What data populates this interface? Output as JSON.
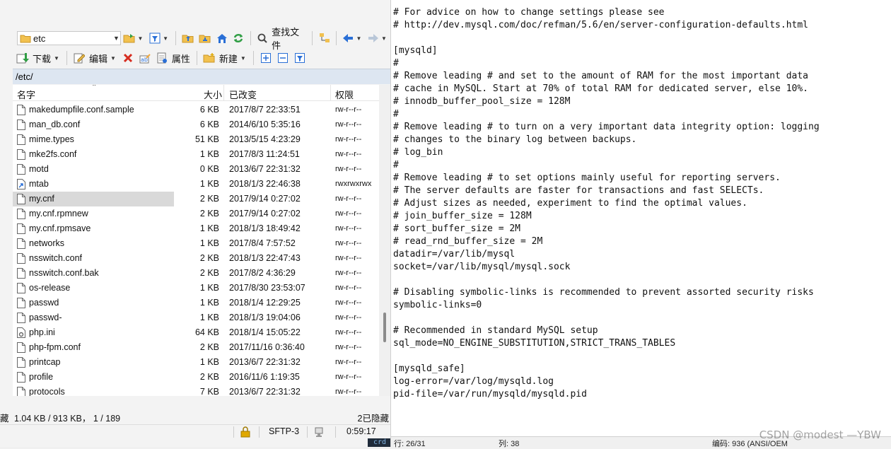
{
  "colors": {
    "accent": "#2a6fd6",
    "folder": "#f2c14e",
    "delete": "#d62d20",
    "refresh": "#2f9e44",
    "selected_row": "#d9d9d9",
    "path_bar": "#dde6f1"
  },
  "toolbar1": {
    "path_combo_value": "etc",
    "find_files_label": "查找文件"
  },
  "toolbar2": {
    "download_label": "下载",
    "edit_label": "编辑",
    "properties_label": "属性",
    "new_label": "新建"
  },
  "path_bar": {
    "value": "/etc/"
  },
  "columns": {
    "name": "名字",
    "size": "大小",
    "modified": "已改变",
    "perms": "权限"
  },
  "files": [
    {
      "name": "makedumpfile.conf.sample",
      "size": "6 KB",
      "date": "2017/8/7 22:33:51",
      "perm": "rw-r--r--",
      "icon": "file-icon"
    },
    {
      "name": "man_db.conf",
      "size": "6 KB",
      "date": "2014/6/10 5:35:16",
      "perm": "rw-r--r--",
      "icon": "file-icon"
    },
    {
      "name": "mime.types",
      "size": "51 KB",
      "date": "2013/5/15 4:23:29",
      "perm": "rw-r--r--",
      "icon": "file-icon"
    },
    {
      "name": "mke2fs.conf",
      "size": "1 KB",
      "date": "2017/8/3 11:24:51",
      "perm": "rw-r--r--",
      "icon": "file-icon"
    },
    {
      "name": "motd",
      "size": "0 KB",
      "date": "2013/6/7 22:31:32",
      "perm": "rw-r--r--",
      "icon": "file-icon"
    },
    {
      "name": "mtab",
      "size": "1 KB",
      "date": "2018/1/3 22:46:38",
      "perm": "rwxrwxrwx",
      "icon": "link-icon"
    },
    {
      "name": "my.cnf",
      "size": "2 KB",
      "date": "2017/9/14 0:27:02",
      "perm": "rw-r--r--",
      "icon": "file-icon"
    },
    {
      "name": "my.cnf.rpmnew",
      "size": "2 KB",
      "date": "2017/9/14 0:27:02",
      "perm": "rw-r--r--",
      "icon": "file-icon"
    },
    {
      "name": "my.cnf.rpmsave",
      "size": "1 KB",
      "date": "2018/1/3 18:49:42",
      "perm": "rw-r--r--",
      "icon": "file-icon"
    },
    {
      "name": "networks",
      "size": "1 KB",
      "date": "2017/8/4 7:57:52",
      "perm": "rw-r--r--",
      "icon": "file-icon"
    },
    {
      "name": "nsswitch.conf",
      "size": "2 KB",
      "date": "2018/1/3 22:47:43",
      "perm": "rw-r--r--",
      "icon": "file-icon"
    },
    {
      "name": "nsswitch.conf.bak",
      "size": "2 KB",
      "date": "2017/8/2 4:36:29",
      "perm": "rw-r--r--",
      "icon": "file-icon"
    },
    {
      "name": "os-release",
      "size": "1 KB",
      "date": "2017/8/30 23:53:07",
      "perm": "rw-r--r--",
      "icon": "file-icon"
    },
    {
      "name": "passwd",
      "size": "1 KB",
      "date": "2018/1/4 12:29:25",
      "perm": "rw-r--r--",
      "icon": "file-icon"
    },
    {
      "name": "passwd-",
      "size": "1 KB",
      "date": "2018/1/3 19:04:06",
      "perm": "rw-r--r--",
      "icon": "file-icon"
    },
    {
      "name": "php.ini",
      "size": "64 KB",
      "date": "2018/1/4 15:05:22",
      "perm": "rw-r--r--",
      "icon": "settings-file-icon"
    },
    {
      "name": "php-fpm.conf",
      "size": "2 KB",
      "date": "2017/11/16 0:36:40",
      "perm": "rw-r--r--",
      "icon": "file-icon"
    },
    {
      "name": "printcap",
      "size": "1 KB",
      "date": "2013/6/7 22:31:32",
      "perm": "rw-r--r--",
      "icon": "file-icon"
    },
    {
      "name": "profile",
      "size": "2 KB",
      "date": "2016/11/6 1:19:35",
      "perm": "rw-r--r--",
      "icon": "file-icon"
    },
    {
      "name": "protocols",
      "size": "7 KB",
      "date": "2013/6/7 22:31:32",
      "perm": "rw-r--r--",
      "icon": "file-icon"
    }
  ],
  "selected_file": "my.cnf",
  "status": {
    "left_cut": "藏",
    "summary": "1.04 KB / 913 KB， 1 / 189",
    "hidden": "2已隐藏",
    "protocol": "SFTP-3",
    "elapsed": "0:59:17",
    "dark_strip": "crd"
  },
  "editor": {
    "lines": [
      "# For advice on how to change settings please see",
      "# http://dev.mysql.com/doc/refman/5.6/en/server-configuration-defaults.html",
      "",
      "[mysqld]",
      "#",
      "# Remove leading # and set to the amount of RAM for the most important data",
      "# cache in MySQL. Start at 70% of total RAM for dedicated server, else 10%.",
      "# innodb_buffer_pool_size = 128M",
      "#",
      "# Remove leading # to turn on a very important data integrity option: logging",
      "# changes to the binary log between backups.",
      "# log_bin",
      "#",
      "# Remove leading # to set options mainly useful for reporting servers.",
      "# The server defaults are faster for transactions and fast SELECTs.",
      "# Adjust sizes as needed, experiment to find the optimal values.",
      "# join_buffer_size = 128M",
      "# sort_buffer_size = 2M",
      "# read_rnd_buffer_size = 2M",
      "datadir=/var/lib/mysql",
      "socket=/var/lib/mysql/mysql.sock",
      "",
      "# Disabling symbolic-links is recommended to prevent assorted security risks",
      "symbolic-links=0",
      "",
      "# Recommended in standard MySQL setup",
      "sql_mode=NO_ENGINE_SUBSTITUTION,STRICT_TRANS_TABLES",
      "",
      "[mysqld_safe]",
      "log-error=/var/log/mysqld.log",
      "pid-file=/var/run/mysqld/mysqld.pid"
    ],
    "status_line": "行: 26/31",
    "status_col": "列: 38",
    "status_encoding": "编码: 936  (ANSI/OEM",
    "watermark": "CSDN @modest —YBW"
  }
}
